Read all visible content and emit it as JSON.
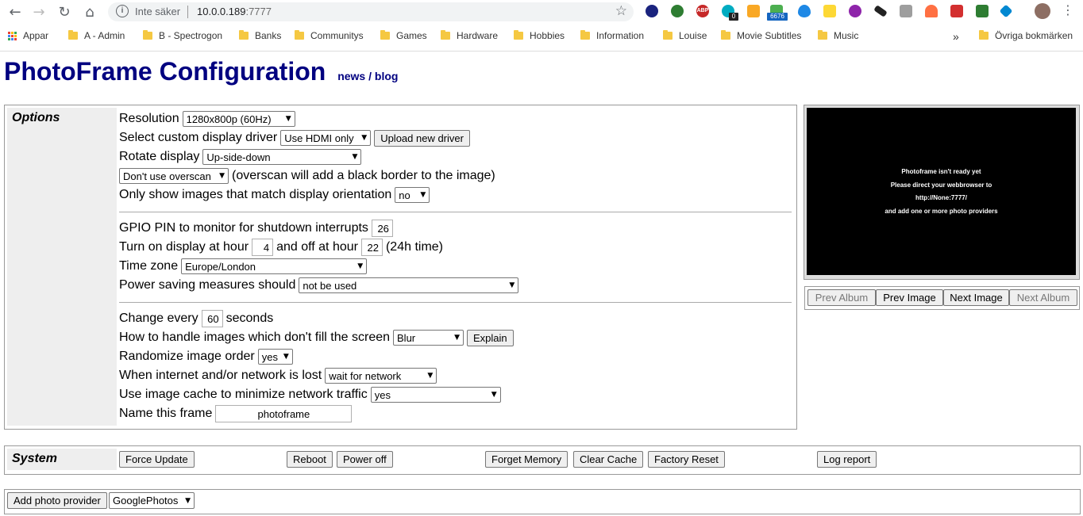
{
  "browser": {
    "secure_label": "Inte säker",
    "url_host": "10.0.0.189",
    "url_port": ":7777",
    "extension_badges": {
      "ext5": "0",
      "ext7": "6676"
    },
    "bookmarks": [
      "Appar",
      "A - Admin",
      "B - Spectrogon",
      "Banks",
      "Communitys",
      "Games",
      "Hardware",
      "Hobbies",
      "Information",
      "Louise",
      "Movie Subtitles",
      "Music"
    ],
    "bookmarks_overflow": "»",
    "other_bookmarks": "Övriga bokmärken"
  },
  "header": {
    "title": "PhotoFrame Configuration",
    "news": "news",
    "sep": " / ",
    "blog": "blog"
  },
  "options": {
    "label": "Options",
    "resolution": {
      "label": "Resolution",
      "value": "1280x800p (60Hz)"
    },
    "driver": {
      "label": "Select custom display driver",
      "value": "Use HDMI only",
      "upload": "Upload new driver"
    },
    "rotate": {
      "label": "Rotate display",
      "value": "Up-side-down"
    },
    "overscan": {
      "value": "Don't use overscan",
      "note": "(overscan will add a black border to the image)"
    },
    "orientation": {
      "label": "Only show images that match display orientation",
      "value": "no"
    },
    "gpio": {
      "label": "GPIO PIN to monitor for shutdown interrupts",
      "value": "26"
    },
    "display_hours": {
      "label_on": "Turn on display at hour",
      "on": "4",
      "label_off": "and off at hour",
      "off": "22",
      "note": "(24h time)"
    },
    "timezone": {
      "label": "Time zone",
      "value": "Europe/London"
    },
    "power": {
      "label": "Power saving measures should",
      "value": "not be used"
    },
    "change": {
      "label": "Change every",
      "value": "60",
      "unit": "seconds"
    },
    "fill": {
      "label": "How to handle images which don't fill the screen",
      "value": "Blur",
      "explain": "Explain"
    },
    "randomize": {
      "label": "Randomize image order",
      "value": "yes"
    },
    "network": {
      "label": "When internet and/or network is lost",
      "value": "wait for network"
    },
    "cache": {
      "label": "Use image cache to minimize network traffic",
      "value": "yes"
    },
    "name": {
      "label": "Name this frame",
      "value": "photoframe"
    }
  },
  "preview": {
    "lines": [
      "Photoframe isn't ready yet",
      "Please direct your webbrowser to",
      "http://None:7777/",
      "and add one or more photo providers"
    ],
    "prev_album": "Prev Album",
    "prev_image": "Prev Image",
    "next_image": "Next Image",
    "next_album": "Next Album"
  },
  "system": {
    "label": "System",
    "force_update": "Force Update",
    "reboot": "Reboot",
    "power_off": "Power off",
    "forget_memory": "Forget Memory",
    "clear_cache": "Clear Cache",
    "factory_reset": "Factory Reset",
    "log_report": "Log report"
  },
  "provider": {
    "add": "Add photo provider",
    "value": "GooglePhotos"
  },
  "colors": {
    "title": "#000080",
    "section_bg": "#eeeeee",
    "preview_bg": "#000000"
  }
}
